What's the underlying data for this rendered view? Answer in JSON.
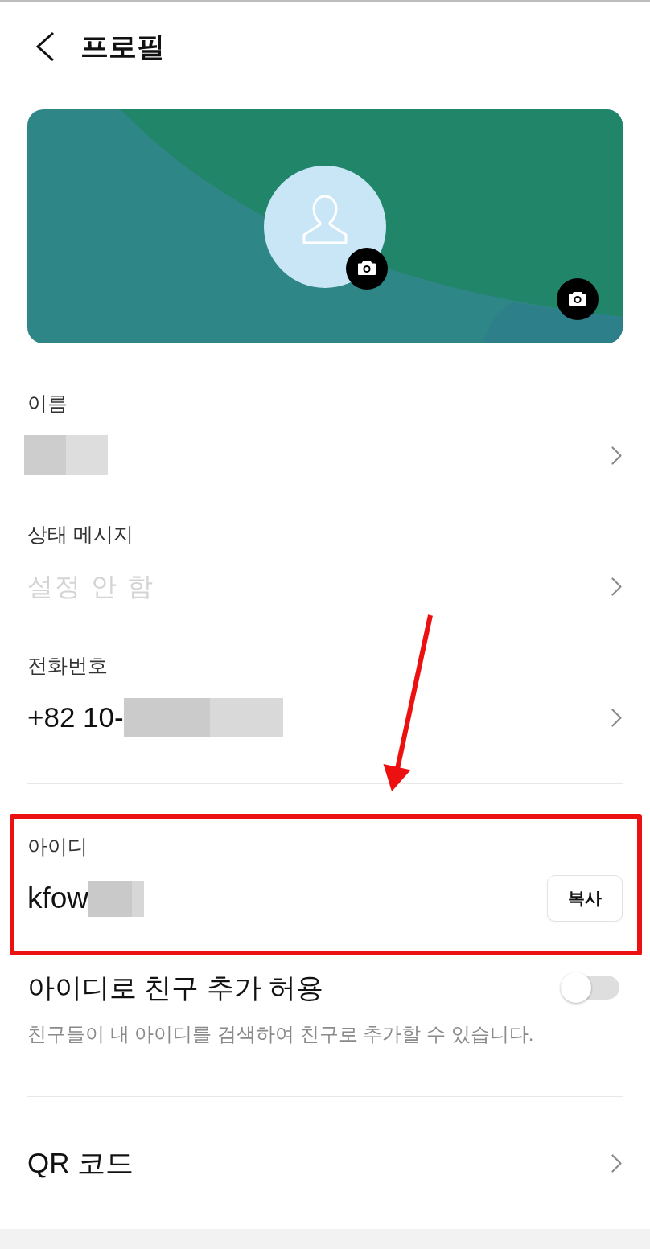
{
  "header": {
    "title": "프로필"
  },
  "sections": [
    {
      "items": [
        {
          "kind": "field",
          "label": "이름",
          "redacted": true
        },
        {
          "kind": "field",
          "label": "상태 메시지",
          "placeholder": "설정 안 함"
        },
        {
          "kind": "field",
          "label": "전화번호",
          "value": "+82 10-",
          "redacted": true
        }
      ]
    },
    {
      "items": [
        {
          "kind": "copy",
          "label": "아이디",
          "value": "kfow",
          "redacted": true,
          "button": "복사",
          "highlighted": true
        },
        {
          "kind": "toggle",
          "label": "아이디로 친구 추가 허용",
          "description": "친구들이 내 아이디를 검색하여 친구로 추가할 수 있습니다.",
          "on": false
        }
      ]
    },
    {
      "items": [
        {
          "kind": "nav",
          "label": "QR 코드"
        }
      ]
    }
  ]
}
